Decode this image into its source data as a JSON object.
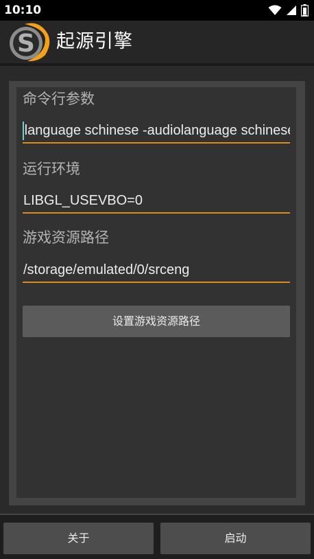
{
  "status_bar": {
    "time": "10:10",
    "icons": [
      "wifi-icon",
      "signal-icon",
      "battery-icon"
    ]
  },
  "title_bar": {
    "logo_icon": "source-engine-logo",
    "title": "起源引擎"
  },
  "form": {
    "command_line": {
      "label": "命令行参数",
      "value": "-language schinese -audiolanguage schinese"
    },
    "environment": {
      "label": "运行环境",
      "value": "LIBGL_USEVBO=0"
    },
    "game_path": {
      "label": "游戏资源路径",
      "value": "/storage/emulated/0/srceng"
    },
    "set_path_button": "设置游戏资源路径"
  },
  "bottom_bar": {
    "about_button": "关于",
    "launch_button": "启动"
  },
  "colors": {
    "accent": "#e08a1e",
    "cursor": "#6cd3d3",
    "logo_orange": "#f5a01a"
  }
}
